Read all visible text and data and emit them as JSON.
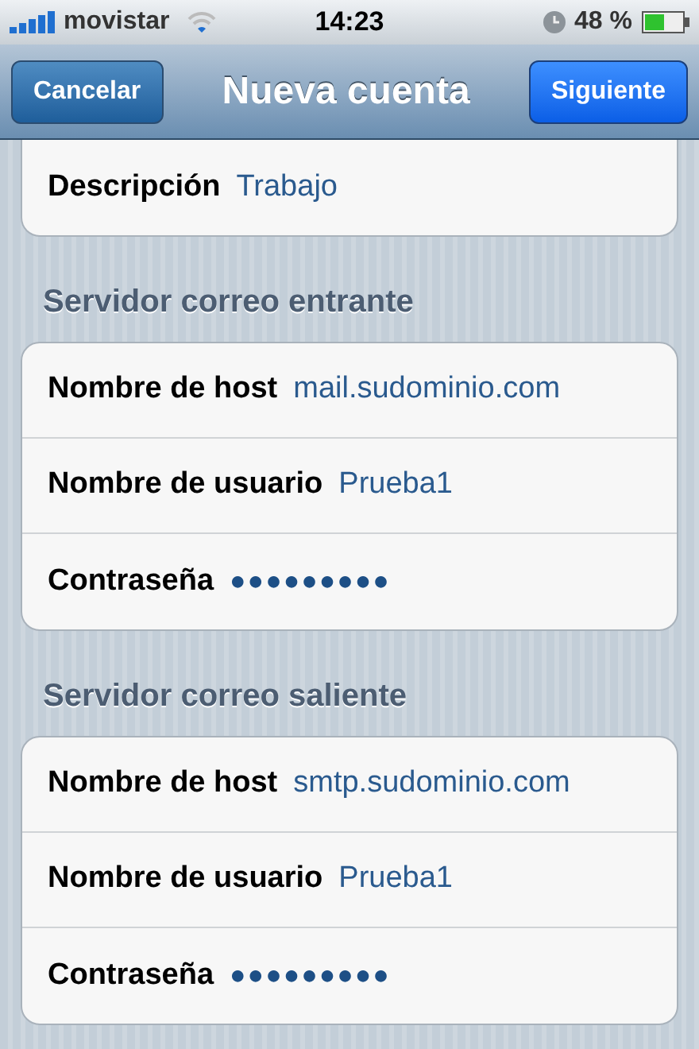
{
  "status_bar": {
    "carrier": "movistar",
    "time": "14:23",
    "battery_text": "48 %"
  },
  "nav_bar": {
    "cancel": "Cancelar",
    "title": "Nueva cuenta",
    "next": "Siguiente"
  },
  "sections": [
    {
      "rows": [
        {
          "label": "Descripción",
          "value": "Trabajo",
          "kind": "text"
        }
      ]
    },
    {
      "header": "Servidor correo entrante",
      "rows": [
        {
          "label": "Nombre de host",
          "value": "mail.sudominio.com",
          "kind": "text"
        },
        {
          "label": "Nombre de usuario",
          "value": "Prueba1",
          "kind": "text"
        },
        {
          "label": "Contraseña",
          "value": "●●●●●●●●●",
          "kind": "secure"
        }
      ]
    },
    {
      "header": "Servidor correo saliente",
      "rows": [
        {
          "label": "Nombre de host",
          "value": "smtp.sudominio.com",
          "kind": "text"
        },
        {
          "label": "Nombre de usuario",
          "value": "Prueba1",
          "kind": "text"
        },
        {
          "label": "Contraseña",
          "value": "●●●●●●●●●",
          "kind": "secure"
        }
      ]
    }
  ]
}
